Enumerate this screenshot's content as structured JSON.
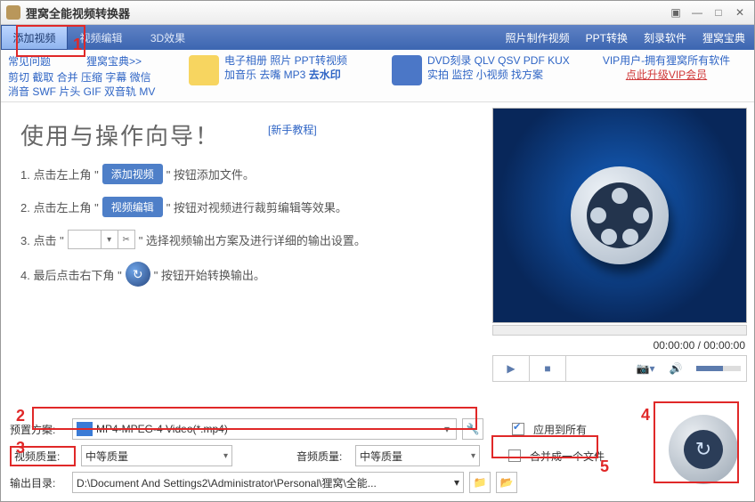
{
  "window": {
    "title": "狸窝全能视频转换器"
  },
  "menu": {
    "tabs": [
      "添加视频",
      "视频编辑",
      "3D效果"
    ],
    "right": [
      "照片制作视频",
      "PPT转换",
      "刻录软件",
      "狸窝宝典"
    ]
  },
  "faq": {
    "hdr_left": "常见问题",
    "hdr_right": "狸窝宝典>>",
    "line1": "剪切 截取 合并 压缩 字幕 微信",
    "line2": "消音 SWF 片头 GIF 双音轨 MV"
  },
  "colA": {
    "line1": "电子相册 照片 PPT转视频",
    "line2": "加音乐 去嘴 MP3 ",
    "bold": "去水印"
  },
  "colB": {
    "line1": "DVD刻录 QLV QSV PDF KUX",
    "line2": "实拍 监控 小视频 找方案"
  },
  "vip": {
    "row1": "VIP用户-拥有狸窝所有软件",
    "row2": "点此升级VIP会员"
  },
  "guide": {
    "heading": "使用与操作向导！",
    "newbie": "[新手教程]",
    "s1a": "1. 点击左上角 \"",
    "s1btn": "添加视频",
    "s1b": "\" 按钮添加文件。",
    "s2a": "2. 点击左上角 \"",
    "s2btn": "视频编辑",
    "s2b": "\" 按钮对视频进行裁剪编辑等效果。",
    "s3a": "3. 点击 \"",
    "s3b": "\" 选择视频输出方案及进行详细的输出设置。",
    "s4a": "4. 最后点击右下角 \"",
    "s4b": "\" 按钮开始转换输出。"
  },
  "preview": {
    "time": "00:00:00 / 00:00:00"
  },
  "form": {
    "preset_label": "预置方案:",
    "preset_value": "MP4-MPEG-4 Video(*.mp4)",
    "apply_all": "应用到所有",
    "vq_label": "视频质量:",
    "vq_value": "中等质量",
    "aq_label": "音频质量:",
    "aq_value": "中等质量",
    "merge": "合并成一个文件",
    "out_label": "输出目录:",
    "out_value": "D:\\Document And Settings2\\Administrator\\Personal\\狸窝\\全能..."
  },
  "ann": {
    "n1": "1",
    "n2": "2",
    "n3": "3",
    "n4": "4",
    "n5": "5"
  }
}
